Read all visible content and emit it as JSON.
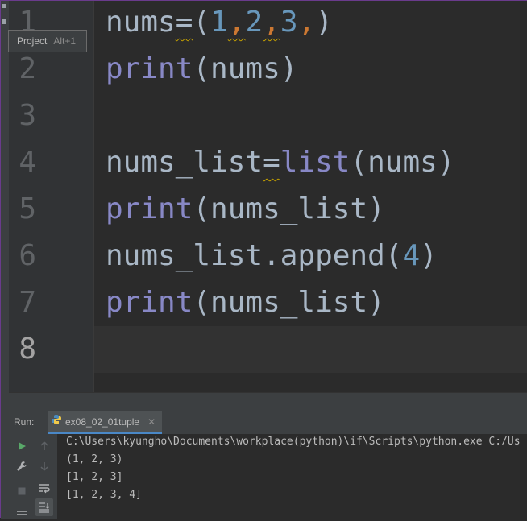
{
  "editor": {
    "line_numbers": [
      "1",
      "2",
      "3",
      "4",
      "5",
      "6",
      "7",
      "8"
    ],
    "current_line": "8",
    "code_lines": [
      {
        "tokens": [
          {
            "t": "nums",
            "c": "id"
          },
          {
            "t": "=",
            "c": "id",
            "wavy": true
          },
          {
            "t": "(",
            "c": "id"
          },
          {
            "t": "1",
            "c": "num"
          },
          {
            "t": ",",
            "c": "com",
            "wavy": true
          },
          {
            "t": "2",
            "c": "num"
          },
          {
            "t": ",",
            "c": "com",
            "wavy": true
          },
          {
            "t": "3",
            "c": "num"
          },
          {
            "t": ",",
            "c": "com"
          },
          {
            "t": ")",
            "c": "id"
          }
        ]
      },
      {
        "tokens": [
          {
            "t": "print",
            "c": "fn"
          },
          {
            "t": "(nums)",
            "c": "id"
          }
        ]
      },
      {
        "tokens": []
      },
      {
        "tokens": [
          {
            "t": "nums_list",
            "c": "id"
          },
          {
            "t": "=",
            "c": "id",
            "wavy": true
          },
          {
            "t": "list",
            "c": "fn"
          },
          {
            "t": "(nums)",
            "c": "id"
          }
        ]
      },
      {
        "tokens": [
          {
            "t": "print",
            "c": "fn"
          },
          {
            "t": "(nums_list)",
            "c": "id"
          }
        ]
      },
      {
        "tokens": [
          {
            "t": "nums_list.append(",
            "c": "id"
          },
          {
            "t": "4",
            "c": "num"
          },
          {
            "t": ")",
            "c": "id"
          }
        ]
      },
      {
        "tokens": [
          {
            "t": "print",
            "c": "fn"
          },
          {
            "t": "(nums_list)",
            "c": "id"
          }
        ]
      },
      {
        "tokens": []
      }
    ]
  },
  "tooltip": {
    "label": "Project",
    "shortcut": "Alt+1"
  },
  "run_panel": {
    "run_label": "Run:",
    "tab_name": "ex08_02_01tuple",
    "tab_close": "✕",
    "console_lines": [
      "C:\\Users\\kyungho\\Documents\\workplace(python)\\if\\Scripts\\python.exe C:/Us",
      "(1, 2, 3)",
      "[1, 2, 3]",
      "[1, 2, 3, 4]"
    ]
  },
  "icons": {
    "run": "play-icon",
    "up": "arrow-up-icon",
    "wrench": "wrench-icon",
    "down": "arrow-down-icon",
    "stop": "stop-icon",
    "wrap": "soft-wrap-icon",
    "scroll": "scroll-to-end-icon",
    "python": "python-icon"
  },
  "colors": {
    "keyword_fn": "#8888c6",
    "number": "#6897bb",
    "comma": "#cc7832",
    "identifier": "#a9b7c6",
    "run_green": "#59a869",
    "background": "#2b2b2b"
  }
}
